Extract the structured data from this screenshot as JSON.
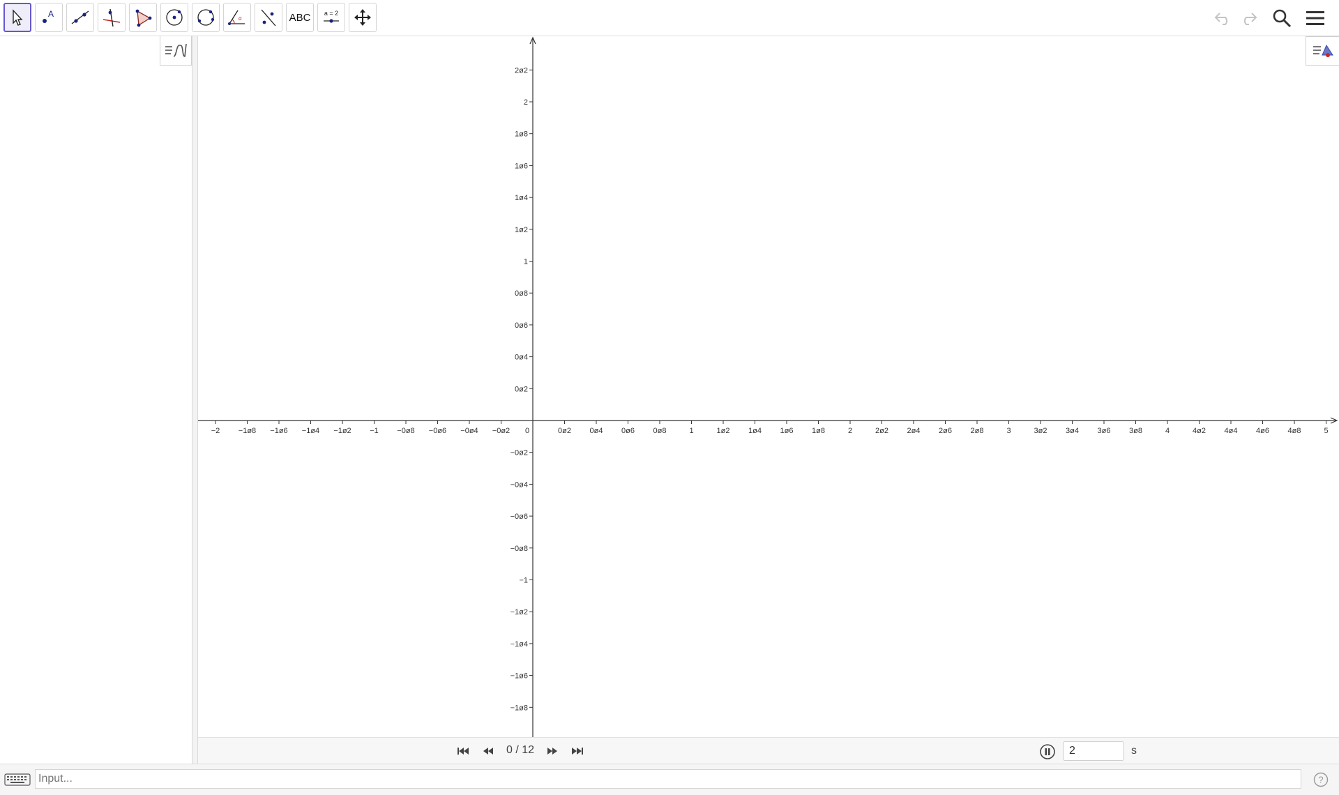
{
  "toolbar": {
    "tools": [
      {
        "name": "move-tool",
        "icon": "arrow-pointer-icon",
        "active": true
      },
      {
        "name": "point-tool",
        "icon": "point-icon",
        "label": "A"
      },
      {
        "name": "line-tool",
        "icon": "line-through-points-icon"
      },
      {
        "name": "perpendicular-line-tool",
        "icon": "perpendicular-line-icon"
      },
      {
        "name": "polygon-tool",
        "icon": "polygon-icon"
      },
      {
        "name": "circle-center-point-tool",
        "icon": "circle-center-icon"
      },
      {
        "name": "circle-three-points-tool",
        "icon": "circle-three-points-icon"
      },
      {
        "name": "angle-tool",
        "icon": "angle-icon"
      },
      {
        "name": "reflect-tool",
        "icon": "reflect-about-line-icon"
      },
      {
        "name": "text-tool",
        "icon": "text-icon",
        "label": "ABC"
      },
      {
        "name": "slider-tool",
        "icon": "slider-icon",
        "label": "a = 2"
      },
      {
        "name": "move-graphics-view-tool",
        "icon": "move-view-icon"
      }
    ],
    "right": [
      "undo-icon",
      "redo-icon",
      "search-icon",
      "menu-icon"
    ]
  },
  "graphics": {
    "x_tick_labels": [
      "−2",
      "−1ø8",
      "−1ø6",
      "−1ø4",
      "−1ø2",
      "−1",
      "−0ø8",
      "−0ø6",
      "−0ø4",
      "−0ø2",
      "0",
      "0ø2",
      "0ø4",
      "0ø6",
      "0ø8",
      "1",
      "1ø2",
      "1ø4",
      "1ø6",
      "1ø8",
      "2",
      "2ø2",
      "2ø4",
      "2ø6",
      "2ø8",
      "3",
      "3ø2",
      "3ø4",
      "3ø6",
      "3ø8",
      "4",
      "4ø2",
      "4ø4",
      "4ø6",
      "4ø8",
      "5"
    ],
    "y_tick_labels_pos": [
      "0ø2",
      "0ø4",
      "0ø6",
      "0ø8",
      "1",
      "1ø2",
      "1ø4",
      "1ø6",
      "1ø8",
      "2",
      "2ø2"
    ],
    "y_tick_labels_neg": [
      "−0ø2",
      "−0ø4",
      "−0ø6",
      "−0ø8",
      "−1",
      "−1ø2",
      "−1ø4",
      "−1ø6",
      "−1ø8"
    ],
    "axis_color": "#333333"
  },
  "animation": {
    "counter": "0 / 12",
    "speed_value": "2",
    "speed_unit": "s"
  },
  "input_bar": {
    "placeholder": "Input..."
  },
  "colors": {
    "accent": "#6557d2",
    "point": "#1a237e"
  }
}
